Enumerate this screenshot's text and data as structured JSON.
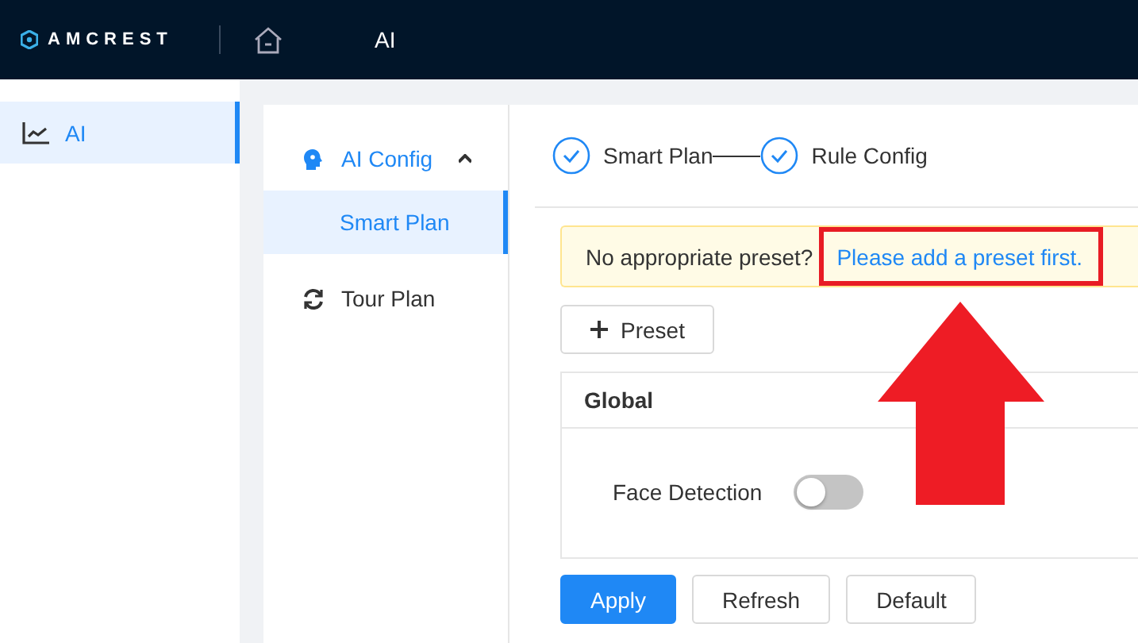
{
  "header": {
    "brand": "AMCREST",
    "page_title": "AI"
  },
  "sidebar": {
    "items": [
      {
        "label": "AI",
        "selected": true
      }
    ]
  },
  "submenu": {
    "group": {
      "label": "AI Config",
      "expanded": true,
      "children": [
        {
          "label": "Smart Plan",
          "selected": true
        }
      ]
    },
    "items": [
      {
        "label": "Tour Plan",
        "selected": false
      }
    ]
  },
  "steps": [
    {
      "label": "Smart Plan",
      "done": true
    },
    {
      "label": "Rule Config",
      "done": true
    }
  ],
  "alert": {
    "text": "No appropriate preset?",
    "link": "Please add a preset first."
  },
  "preset_button": "Preset",
  "global": {
    "title": "Global",
    "rows": [
      {
        "label": "Face Detection",
        "on": false
      }
    ]
  },
  "buttons": [
    {
      "label": "Apply",
      "primary": true
    },
    {
      "label": "Refresh",
      "primary": false
    },
    {
      "label": "Default",
      "primary": false
    }
  ]
}
